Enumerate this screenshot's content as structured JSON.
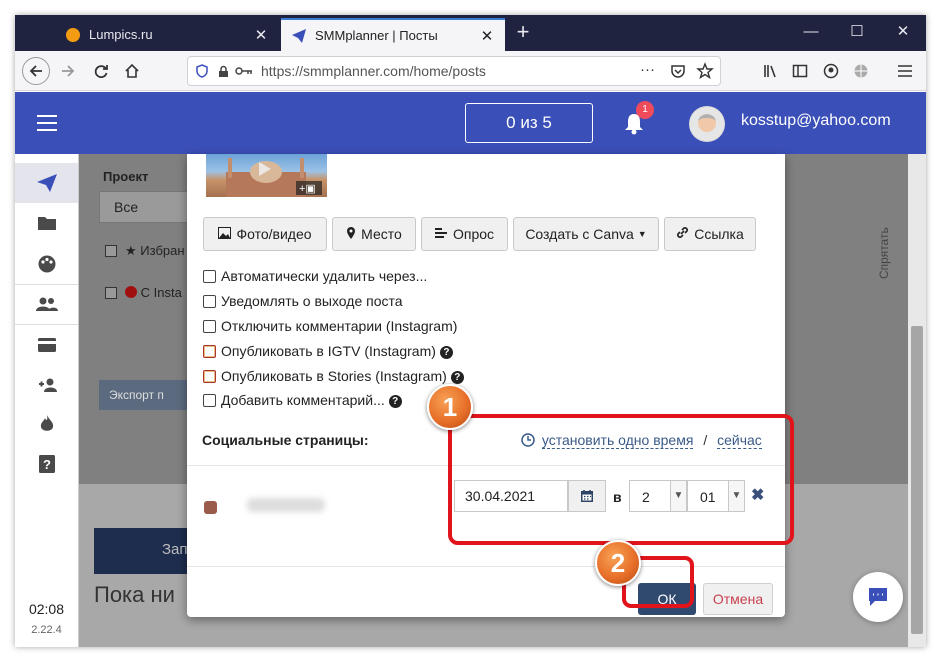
{
  "browser": {
    "tabs": [
      {
        "title": "Lumpics.ru",
        "active": false
      },
      {
        "title": "SMMplanner | Посты",
        "active": true
      }
    ],
    "url": "https://smmplanner.com/home/posts",
    "window_controls": [
      "—",
      "☐",
      "✕"
    ]
  },
  "header": {
    "counter": "0 из 5",
    "notif_count": "1",
    "email": "kosstup@yahoo.com",
    "accent": "#3b4fb8"
  },
  "sidebar": {
    "icons": [
      "send-icon",
      "folder-icon",
      "palette-icon",
      "users-icon",
      "card-icon",
      "add-user-icon",
      "fire-icon",
      "help-icon"
    ],
    "time": "02:08",
    "version": "2.22.4"
  },
  "background": {
    "project_label": "Проект",
    "project_value": "Все",
    "favorites": "Избран",
    "instagram": "С Insta",
    "export": "Экспорт п",
    "create": "Зап",
    "empty": "Пока ни",
    "hide": "Спрятать"
  },
  "modal": {
    "toolbar": {
      "photo": "Фото/видео",
      "place": "Место",
      "poll": "Опрос",
      "canva": "Создать с Canva",
      "link": "Ссылка"
    },
    "options": [
      {
        "label": "Автоматически удалить через...",
        "help": false
      },
      {
        "label": "Уведомлять о выходе поста",
        "help": false
      },
      {
        "label": "Отключить комментарии (Instagram)",
        "help": false
      },
      {
        "label": "Опубликовать в IGTV (Instagram)",
        "help": true
      },
      {
        "label": "Опубликовать в Stories (Instagram)",
        "help": true
      },
      {
        "label": "Добавить комментарий...",
        "help": true
      }
    ],
    "social_label": "Социальные страницы:",
    "set_one_time": "установить одно время",
    "separator": "/",
    "now": "сейчас",
    "date": "30.04.2021",
    "at": "в",
    "hour": "2",
    "minute": "01",
    "ok": "ОК",
    "cancel": "Отмена"
  },
  "annotations": {
    "step1": "1",
    "step2": "2"
  }
}
